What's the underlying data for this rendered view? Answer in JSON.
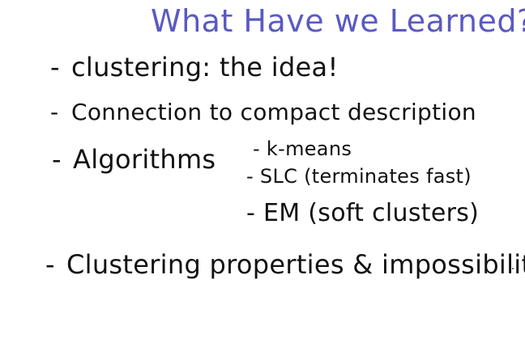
{
  "title": "What Have we Learned?",
  "bullets": {
    "marker": "-",
    "clustering_idea": "clustering: the idea!",
    "compact_description": "Connection to compact description",
    "algorithms": "Algorithms",
    "algorithm_items": [
      "k-means",
      "SLC (terminates fast)",
      "EM (soft clusters)"
    ],
    "properties": "Clustering properties & impossibility"
  },
  "colors": {
    "title": "#5a5ac2",
    "ink": "#111111",
    "background": "#ffffff"
  }
}
